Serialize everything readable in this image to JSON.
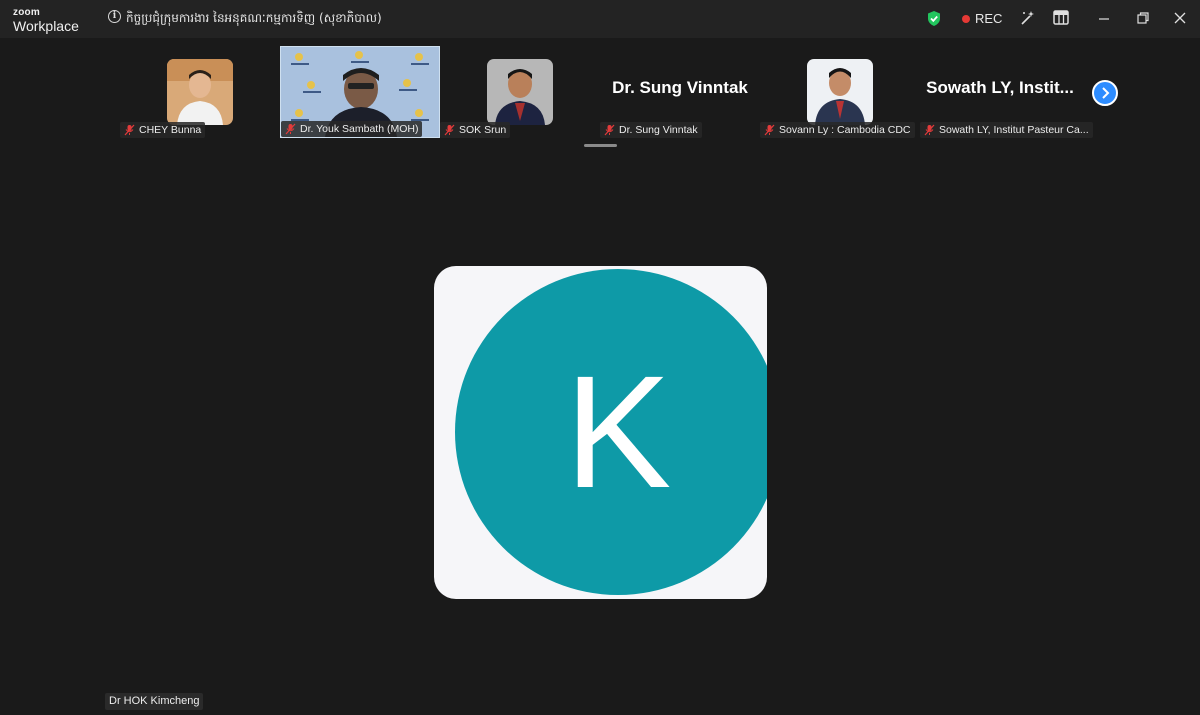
{
  "app": {
    "logo_top": "zoom",
    "logo_bottom": "Workplace"
  },
  "meeting": {
    "title": "កិច្ចប្រជុំក្រុមការងារ នៃអនុគណៈកម្មការទិញ (សុខាភិបាល)"
  },
  "toolbar": {
    "rec_label": "REC"
  },
  "participants": [
    {
      "name": "CHEY Bunna",
      "display": "photo"
    },
    {
      "name": "Dr. Youk Sambath (MOH)",
      "display": "video"
    },
    {
      "name": "SOK Srun",
      "display": "photo"
    },
    {
      "name": "Dr. Sung Vinntak",
      "display": "name",
      "big_name": "Dr. Sung Vinntak"
    },
    {
      "name": "Sovann Ly : Cambodia CDC",
      "display": "photo"
    },
    {
      "name": "Sowath LY, Institut Pasteur Ca...",
      "display": "name",
      "big_name": "Sowath LY, Instit..."
    }
  ],
  "main_speaker": {
    "name": "Dr HOK Kimcheng",
    "avatar_letter": "K",
    "avatar_color": "#0e9aa7"
  },
  "colors": {
    "accent": "#2d8cff",
    "rec": "#e53935",
    "shield": "#22c55e"
  }
}
